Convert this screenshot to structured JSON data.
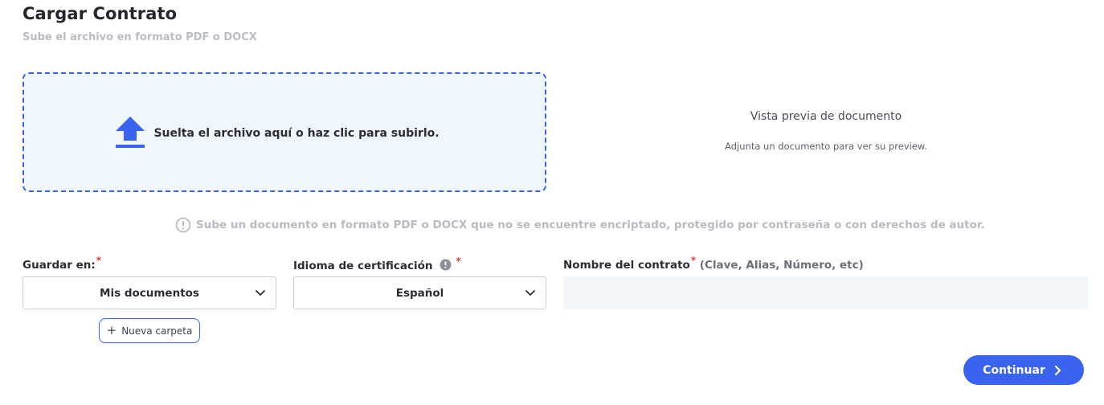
{
  "header": {
    "title": "Cargar Contrato",
    "subtitle": "Sube el archivo en formato PDF o DOCX"
  },
  "dropzone": {
    "text": "Suelta el archivo aquí o haz clic para subirlo.",
    "icon": "upload-icon"
  },
  "preview": {
    "title": "Vista previa de documento",
    "subtitle": "Adjunta un documento para ver su preview."
  },
  "notice": {
    "text": "Sube un documento en formato PDF o DOCX que no se encuentre encriptado, protegido por contraseña o con derechos de autor.",
    "icon": "alert-circle-icon"
  },
  "form": {
    "save_in": {
      "label": "Guardar en:",
      "required_mark": "*",
      "value": "Mis documentos"
    },
    "language": {
      "label": "Idioma de certificación",
      "required_mark": "*",
      "value": "Español"
    },
    "contract_name": {
      "label": "Nombre del contrato",
      "required_mark": "*",
      "hint": " (Clave, Alias, Número, etc)",
      "value": ""
    },
    "new_folder_label": "Nueva carpeta",
    "new_folder_plus": "+"
  },
  "actions": {
    "continue_label": "Continuar"
  },
  "colors": {
    "accent": "#3a63f0",
    "dropzone_bg": "#f0f7fc",
    "required": "#e23a3a",
    "muted_text": "#b8bbc1"
  }
}
